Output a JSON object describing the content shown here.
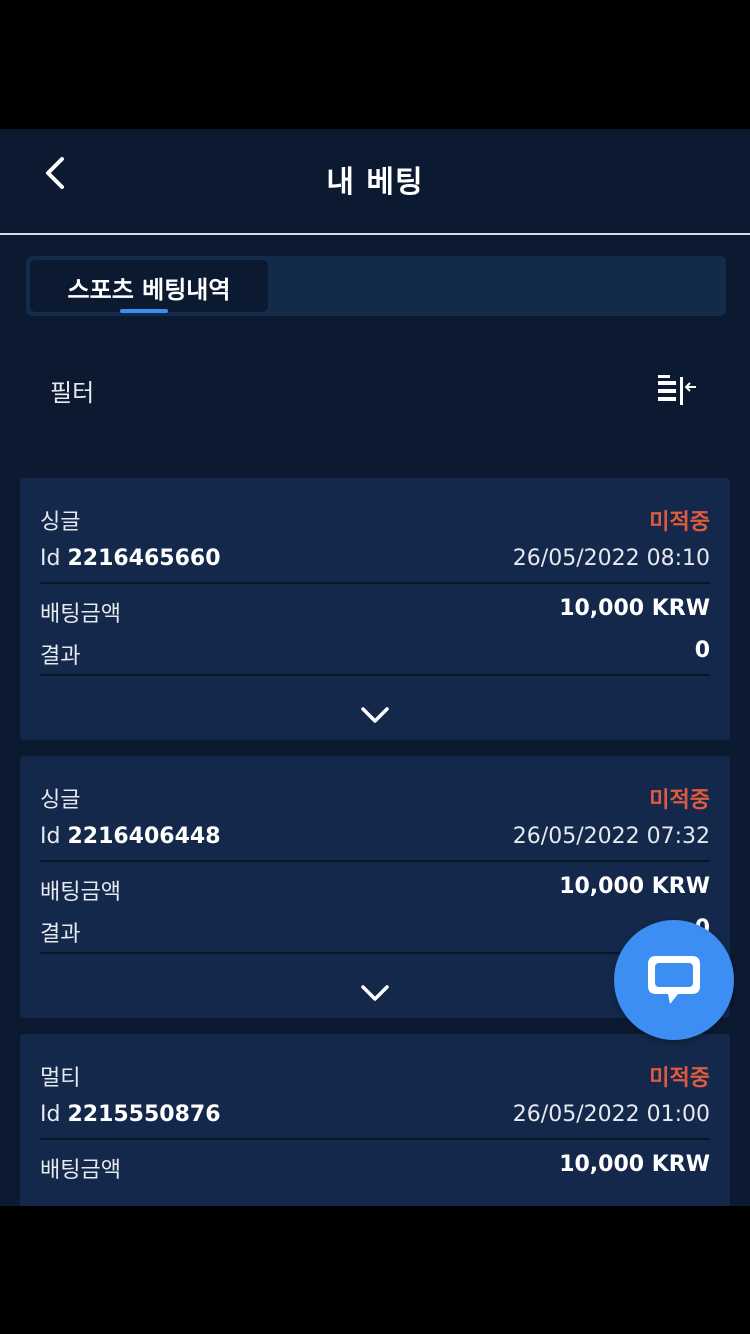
{
  "header": {
    "title": "내 베팅",
    "back_icon": "chevron-left-icon"
  },
  "tabs": [
    {
      "label": "스포츠 베팅내역",
      "active": true
    }
  ],
  "filter": {
    "label": "필터",
    "icon": "filter-collapse-icon"
  },
  "colors": {
    "background": "#0b1a30",
    "card": "#13284a",
    "accent": "#3b8ff0",
    "status_pending": "#e05a3e",
    "fab": "#3d8ef2"
  },
  "bets": [
    {
      "type": "싱글",
      "status": "미적중",
      "id_label": "Id",
      "id": "2216465660",
      "datetime": "26/05/2022 08:10",
      "stake_label": "배팅금액",
      "stake": "10,000 KRW",
      "result_label": "결과",
      "result": "0"
    },
    {
      "type": "싱글",
      "status": "미적중",
      "id_label": "Id",
      "id": "2216406448",
      "datetime": "26/05/2022 07:32",
      "stake_label": "배팅금액",
      "stake": "10,000 KRW",
      "result_label": "결과",
      "result": "0"
    },
    {
      "type": "멀티",
      "status": "미적중",
      "id_label": "Id",
      "id": "2215550876",
      "datetime": "26/05/2022 01:00",
      "stake_label": "배팅금액",
      "stake": "10,000 KRW"
    }
  ],
  "chat": {
    "icon": "chat-bubble-icon"
  }
}
